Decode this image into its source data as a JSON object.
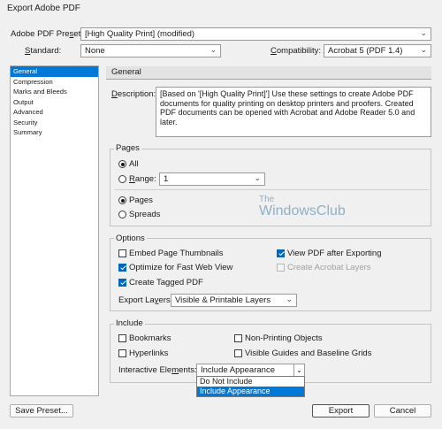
{
  "window": {
    "title": "Export Adobe PDF"
  },
  "top": {
    "preset_label": "Adobe PDF Preset:",
    "preset_value": "[High Quality Print] (modified)",
    "standard_label": "Standard:",
    "standard_value": "None",
    "compat_label": "Compatibility:",
    "compat_value": "Acrobat 5 (PDF 1.4)"
  },
  "sidebar": {
    "items": [
      {
        "label": "General",
        "active": true
      },
      {
        "label": "Compression"
      },
      {
        "label": "Marks and Bleeds"
      },
      {
        "label": "Output"
      },
      {
        "label": "Advanced"
      },
      {
        "label": "Security"
      },
      {
        "label": "Summary"
      }
    ]
  },
  "main": {
    "header": "General",
    "description_label": "Description:",
    "description": "[Based on '[High Quality Print]'] Use these settings to create Adobe PDF documents for quality printing on desktop printers and proofers.  Created PDF documents can be opened with Acrobat and Adobe Reader 5.0 and later."
  },
  "pages": {
    "title": "Pages",
    "all_label": "All",
    "range_label": "Range:",
    "range_value": "1",
    "pages_label": "Pages",
    "spreads_label": "Spreads",
    "all_selected": true,
    "pages_selected": true
  },
  "options": {
    "title": "Options",
    "embed_thumbs": "Embed Page Thumbnails",
    "optimize_web": "Optimize for Fast Web View",
    "create_tagged": "Create Tagged PDF",
    "view_after": "View PDF after Exporting",
    "create_layers": "Create Acrobat Layers",
    "export_layers_label": "Export Layers:",
    "export_layers_value": "Visible & Printable Layers",
    "checked": {
      "embed_thumbs": false,
      "optimize_web": true,
      "create_tagged": true,
      "view_after": true,
      "create_layers": false
    }
  },
  "include": {
    "title": "Include",
    "bookmarks": "Bookmarks",
    "hyperlinks": "Hyperlinks",
    "non_printing": "Non-Printing Objects",
    "visible_guides": "Visible Guides and Baseline Grids",
    "interactive_label": "Interactive Elements:",
    "interactive_value": "Include Appearance",
    "dropdown_options": [
      "Do Not Include",
      "Include Appearance"
    ],
    "selected_option": "Include Appearance"
  },
  "watermark": {
    "line1": "The",
    "line2": "WindowsClub"
  },
  "buttons": {
    "save_preset": "Save Preset...",
    "export": "Export",
    "cancel": "Cancel"
  }
}
